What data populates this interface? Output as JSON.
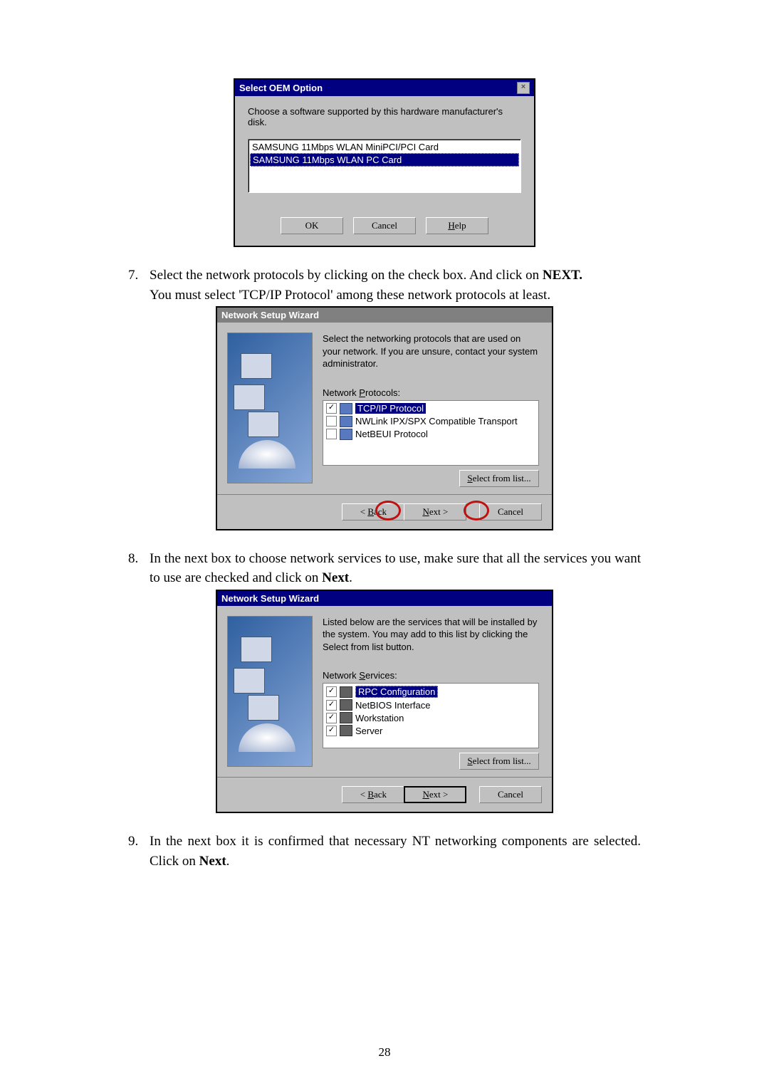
{
  "dlg1": {
    "title": "Select OEM Option",
    "prompt": "Choose a software supported by this hardware manufacturer's disk.",
    "items": [
      "SAMSUNG 11Mbps WLAN MiniPCI/PCI Card",
      "SAMSUNG 11Mbps WLAN PC Card"
    ],
    "ok": "OK",
    "cancel": "Cancel",
    "help": "Help"
  },
  "step7": {
    "num": "7.",
    "line1": "Select the network protocols by clicking on the check box. And click on ",
    "bold1": "NEXT.",
    "line2": "You must select 'TCP/IP Protocol' among these network protocols at least."
  },
  "wiz1": {
    "title": "Network Setup Wizard",
    "desc": "Select the networking protocols that are used on your network. If you are unsure, contact your system administrator.",
    "listlabel": "Network Protocols:",
    "items": [
      {
        "chk": true,
        "label": "TCP/IP Protocol",
        "sel": true
      },
      {
        "chk": false,
        "label": "NWLink IPX/SPX Compatible Transport"
      },
      {
        "chk": false,
        "label": "NetBEUI Protocol"
      }
    ],
    "selectfrom": "Select from list...",
    "back": "< Back",
    "next": "Next >",
    "cancel": "Cancel"
  },
  "step8": {
    "num": "8.",
    "line1": "In the next box to choose network services to use, make sure that all the services you want to use are checked and click on ",
    "bold1": "Next",
    "tail": "."
  },
  "wiz2": {
    "title": "Network Setup Wizard",
    "desc": "Listed below are the services that will be installed by the system. You may add to this list by clicking the Select from list button.",
    "listlabel": "Network Services:",
    "items": [
      {
        "chk": true,
        "label": "RPC Configuration",
        "sel": true
      },
      {
        "chk": true,
        "label": "NetBIOS Interface"
      },
      {
        "chk": true,
        "label": "Workstation"
      },
      {
        "chk": true,
        "label": "Server"
      }
    ],
    "selectfrom": "Select from list...",
    "back": "< Back",
    "next": "Next >",
    "cancel": "Cancel"
  },
  "step9": {
    "num": "9.",
    "text": "In the next box it is confirmed that necessary NT networking components are selected. Click on ",
    "bold": "Next",
    "tail": "."
  },
  "pagenum": "28"
}
